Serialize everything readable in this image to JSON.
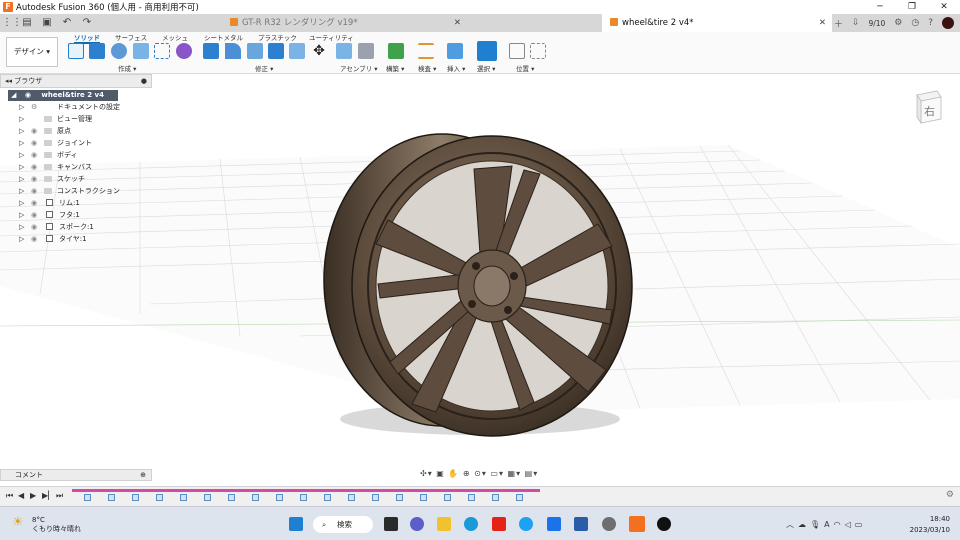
{
  "window": {
    "title": "Autodesk Fusion 360 (個人用 - 商用利用不可)"
  },
  "tabs": {
    "inactive_label": "GT-R R32  レンダリング  v19*",
    "active_label": "wheel&tire 2 v4*",
    "job_count": "9/10"
  },
  "ribbon": {
    "workspace": "デザイン",
    "tabs": [
      "ソリッド",
      "サーフェス",
      "メッシュ",
      "シートメタル",
      "プラスチック",
      "ユーティリティ"
    ],
    "groups": [
      "作成",
      "修正",
      "アセンブリ",
      "構築",
      "検査",
      "挿入",
      "選択",
      "位置"
    ]
  },
  "browser": {
    "header": "ブラウザ",
    "root": "wheel&tire 2 v4",
    "items": [
      "ドキュメントの設定",
      "ビュー管理",
      "原点",
      "ジョイント",
      "ボディ",
      "キャンバス",
      "スケッチ",
      "コンストラクション",
      "リム:1",
      "フタ:1",
      "スポーク:1",
      "タイヤ:1"
    ]
  },
  "comment_bar": {
    "label": "コメント"
  },
  "viewcube": {
    "face_label": "右"
  },
  "taskbar": {
    "temperature": "8°C",
    "weather": "くもり時々晴れ",
    "search_label": "検索",
    "time": "18:40",
    "date": "2023/03/10"
  },
  "colors": {
    "accent": "#0a6ab0",
    "root_row": "#4f5b6b",
    "timeline_bar": "#d64aa5",
    "wheel": "#5a4a3a"
  }
}
